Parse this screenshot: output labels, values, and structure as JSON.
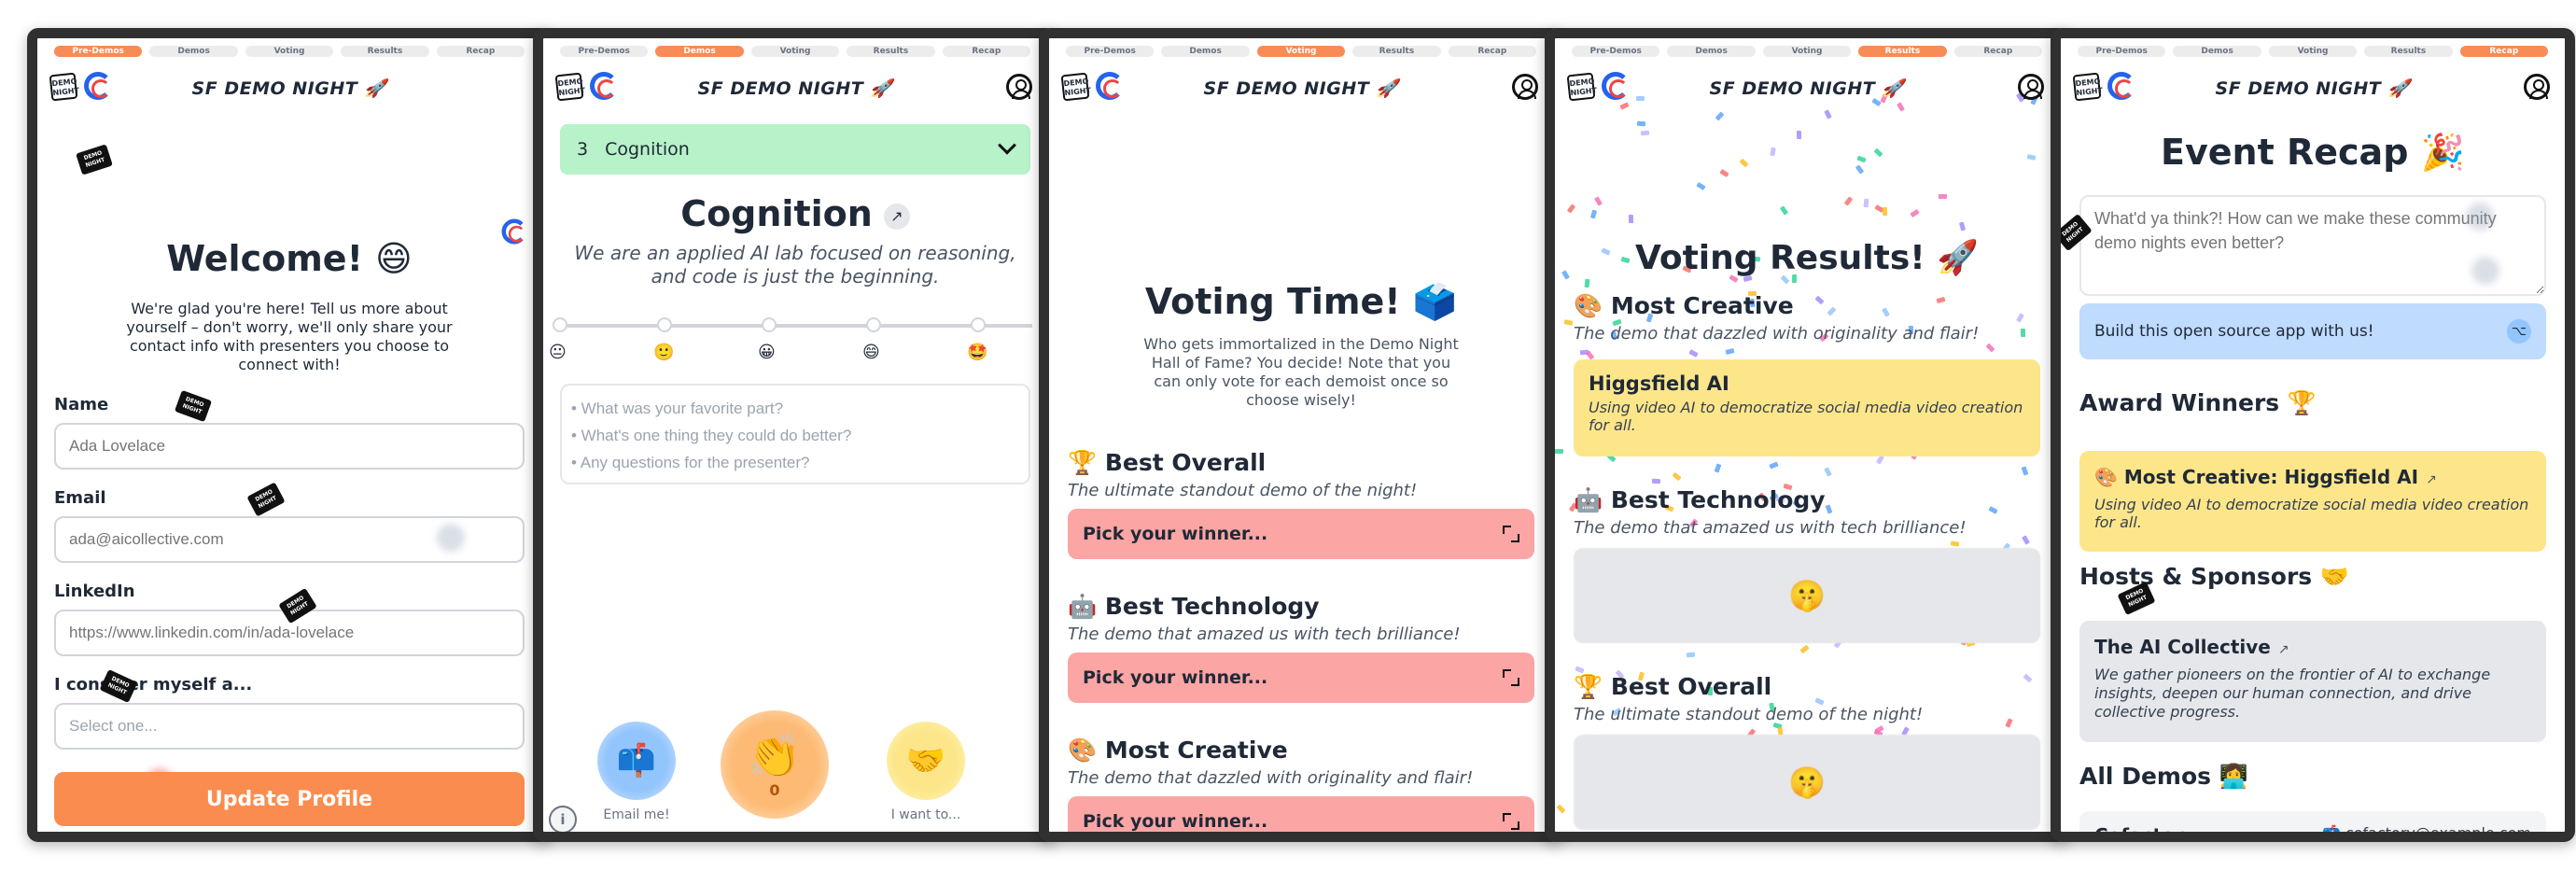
{
  "steps": [
    "Pre-Demos",
    "Demos",
    "Voting",
    "Results",
    "Recap"
  ],
  "brand": "SF DEMO NIGHT 🚀",
  "logo_text": "DEMO NIGHT",
  "screen1": {
    "title": "Welcome! 😄",
    "intro": "We're glad you're here! Tell us more about yourself – don't worry, we'll only share your contact info with presenters you choose to connect with!",
    "fields": [
      {
        "label": "Name",
        "placeholder": "Ada Lovelace"
      },
      {
        "label": "Email",
        "placeholder": "ada@aicollective.com"
      },
      {
        "label": "LinkedIn",
        "placeholder": "https://www.linkedin.com/in/ada-lovelace"
      },
      {
        "label": "I consider myself a...",
        "placeholder": "Select one..."
      }
    ],
    "submit": "Update Profile"
  },
  "screen2": {
    "select_number": "3",
    "select_name": "Cognition",
    "demo_title": "Cognition",
    "demo_desc": "We are an applied AI lab focused on reasoning, and code is just the beginning.",
    "rating_emojis": [
      "😐",
      "🙂",
      "😀",
      "😄",
      "🤩"
    ],
    "feedback_lines": [
      "• What was your favorite part?",
      "• What's one thing they could do better?",
      "• Any questions for the presenter?"
    ],
    "email_label": "Email me!",
    "clap_count": "0",
    "want_label": "I want to...",
    "email_emoji": "📫",
    "clap_emoji": "👏",
    "want_emoji": "🤝",
    "info": "i"
  },
  "screen3": {
    "title": "Voting Time! 🗳️",
    "intro": "Who gets immortalized in the Demo Night Hall of Fame? You decide! Note that you can only vote for each demoist once so choose wisely!",
    "categories": [
      {
        "title": "🏆 Best Overall",
        "sub": "The ultimate standout demo of the night!",
        "pick": "Pick your winner..."
      },
      {
        "title": "🤖 Best Technology",
        "sub": "The demo that amazed us with tech brilliance!",
        "pick": "Pick your winner..."
      },
      {
        "title": "🎨 Most Creative",
        "sub": "The demo that dazzled with originality and flair!",
        "pick": "Pick your winner..."
      }
    ]
  },
  "screen4": {
    "title": "Voting Results! 🚀",
    "categories": [
      {
        "title": "🎨 Most Creative",
        "sub": "The demo that dazzled with originality and flair!"
      },
      {
        "title": "🤖 Best Technology",
        "sub": "The demo that amazed us with tech brilliance!"
      },
      {
        "title": "🏆 Best Overall",
        "sub": "The ultimate standout demo of the night!"
      }
    ],
    "winner_name": "Higgsfield AI",
    "winner_desc": "Using video AI to democratize social media video creation for all.",
    "mystery_emoji": "🤫"
  },
  "screen5": {
    "title": "Event Recap 🎉",
    "feedback_placeholder": "What'd ya think?! How can we make these community demo nights even better?",
    "oss_label": "Build this open source app with us!",
    "awards_title": "Award Winners 🏆",
    "award_name": "🎨 Most Creative: Higgsfield AI",
    "award_desc": "Using video AI to democratize social media video creation for all.",
    "hosts_title": "Hosts & Sponsors 🤝",
    "host_name": "The AI Collective",
    "host_desc": "We gather pioneers on the frontier of AI to exchange insights, deepen our human connection, and drive collective progress.",
    "demos_title": "All Demos 👩‍💻",
    "demo_name": "Cofactory",
    "demo_email": "📫 cofactory@example.com",
    "arrow": "↗"
  },
  "colors": {
    "accent_orange": "#f98b56",
    "select_green": "#b7f2c8",
    "pick_red": "#fca5a5",
    "winner_yellow": "#fde68a",
    "oss_blue": "#bfdbfe"
  }
}
